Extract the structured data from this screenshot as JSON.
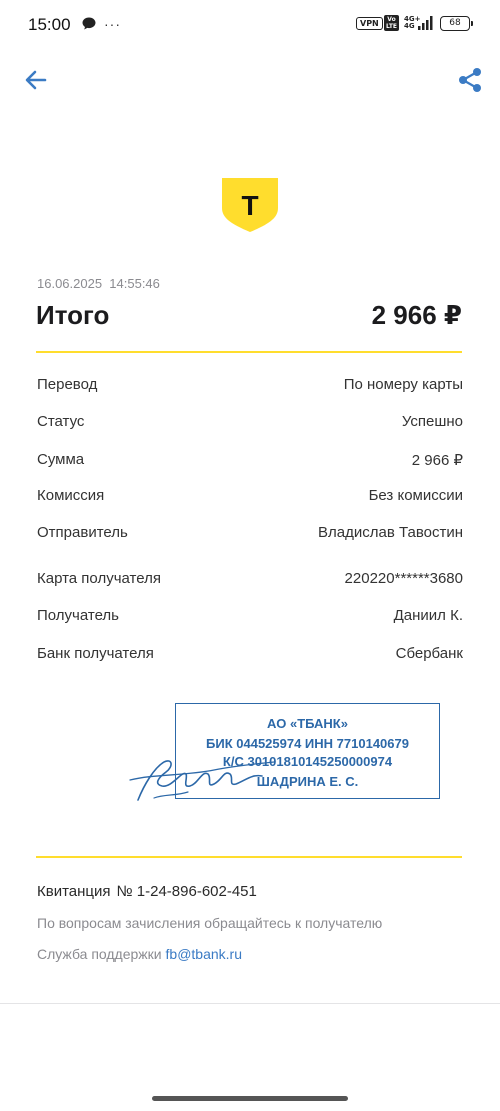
{
  "status_bar": {
    "time": "15:00",
    "more": "···",
    "vpn": "VPN",
    "volte": "Vo LTE",
    "network_top": "4G+",
    "network_bottom": "4G",
    "battery": "68"
  },
  "toolbar": {
    "back_icon": "arrow-left-icon",
    "share_icon": "share-icon",
    "accent_color": "#3b7bc4"
  },
  "logo": {
    "letter": "T",
    "color": "#ffdd2d"
  },
  "header": {
    "datetime": "16.06.2025  14:55:46",
    "total_label": "Итого",
    "total_amount": "2 966 ₽"
  },
  "details": [
    {
      "label": "Перевод",
      "value": "По номеру карты"
    },
    {
      "label": "Статус",
      "value": "Успешно"
    },
    {
      "label": "Сумма",
      "value": "2 966 ₽"
    },
    {
      "label": "Комиссия",
      "value": "Без комиссии"
    },
    {
      "label": "Отправитель",
      "value": "Владислав Тавостин"
    },
    {
      "label": "Карта получателя",
      "value": "220220******3680"
    },
    {
      "label": "Получатель",
      "value": "Даниил К."
    },
    {
      "label": "Банк получателя",
      "value": "Сбербанк"
    }
  ],
  "stamp": {
    "line1": "АО «ТБАНК»",
    "line2": "БИК 044525974 ИНН 7710140679",
    "line3": "К/С 30101810145250000974",
    "line4": "ШАДРИНА Е. С.",
    "color": "#2c68a8"
  },
  "footer": {
    "receipt_label": "Квитанция",
    "receipt_number": "№ 1-24-896-602-451",
    "info": "По вопросам зачисления обращайтесь к получателю",
    "support_label": "Служба поддержки",
    "support_email": "fb@tbank.ru"
  }
}
